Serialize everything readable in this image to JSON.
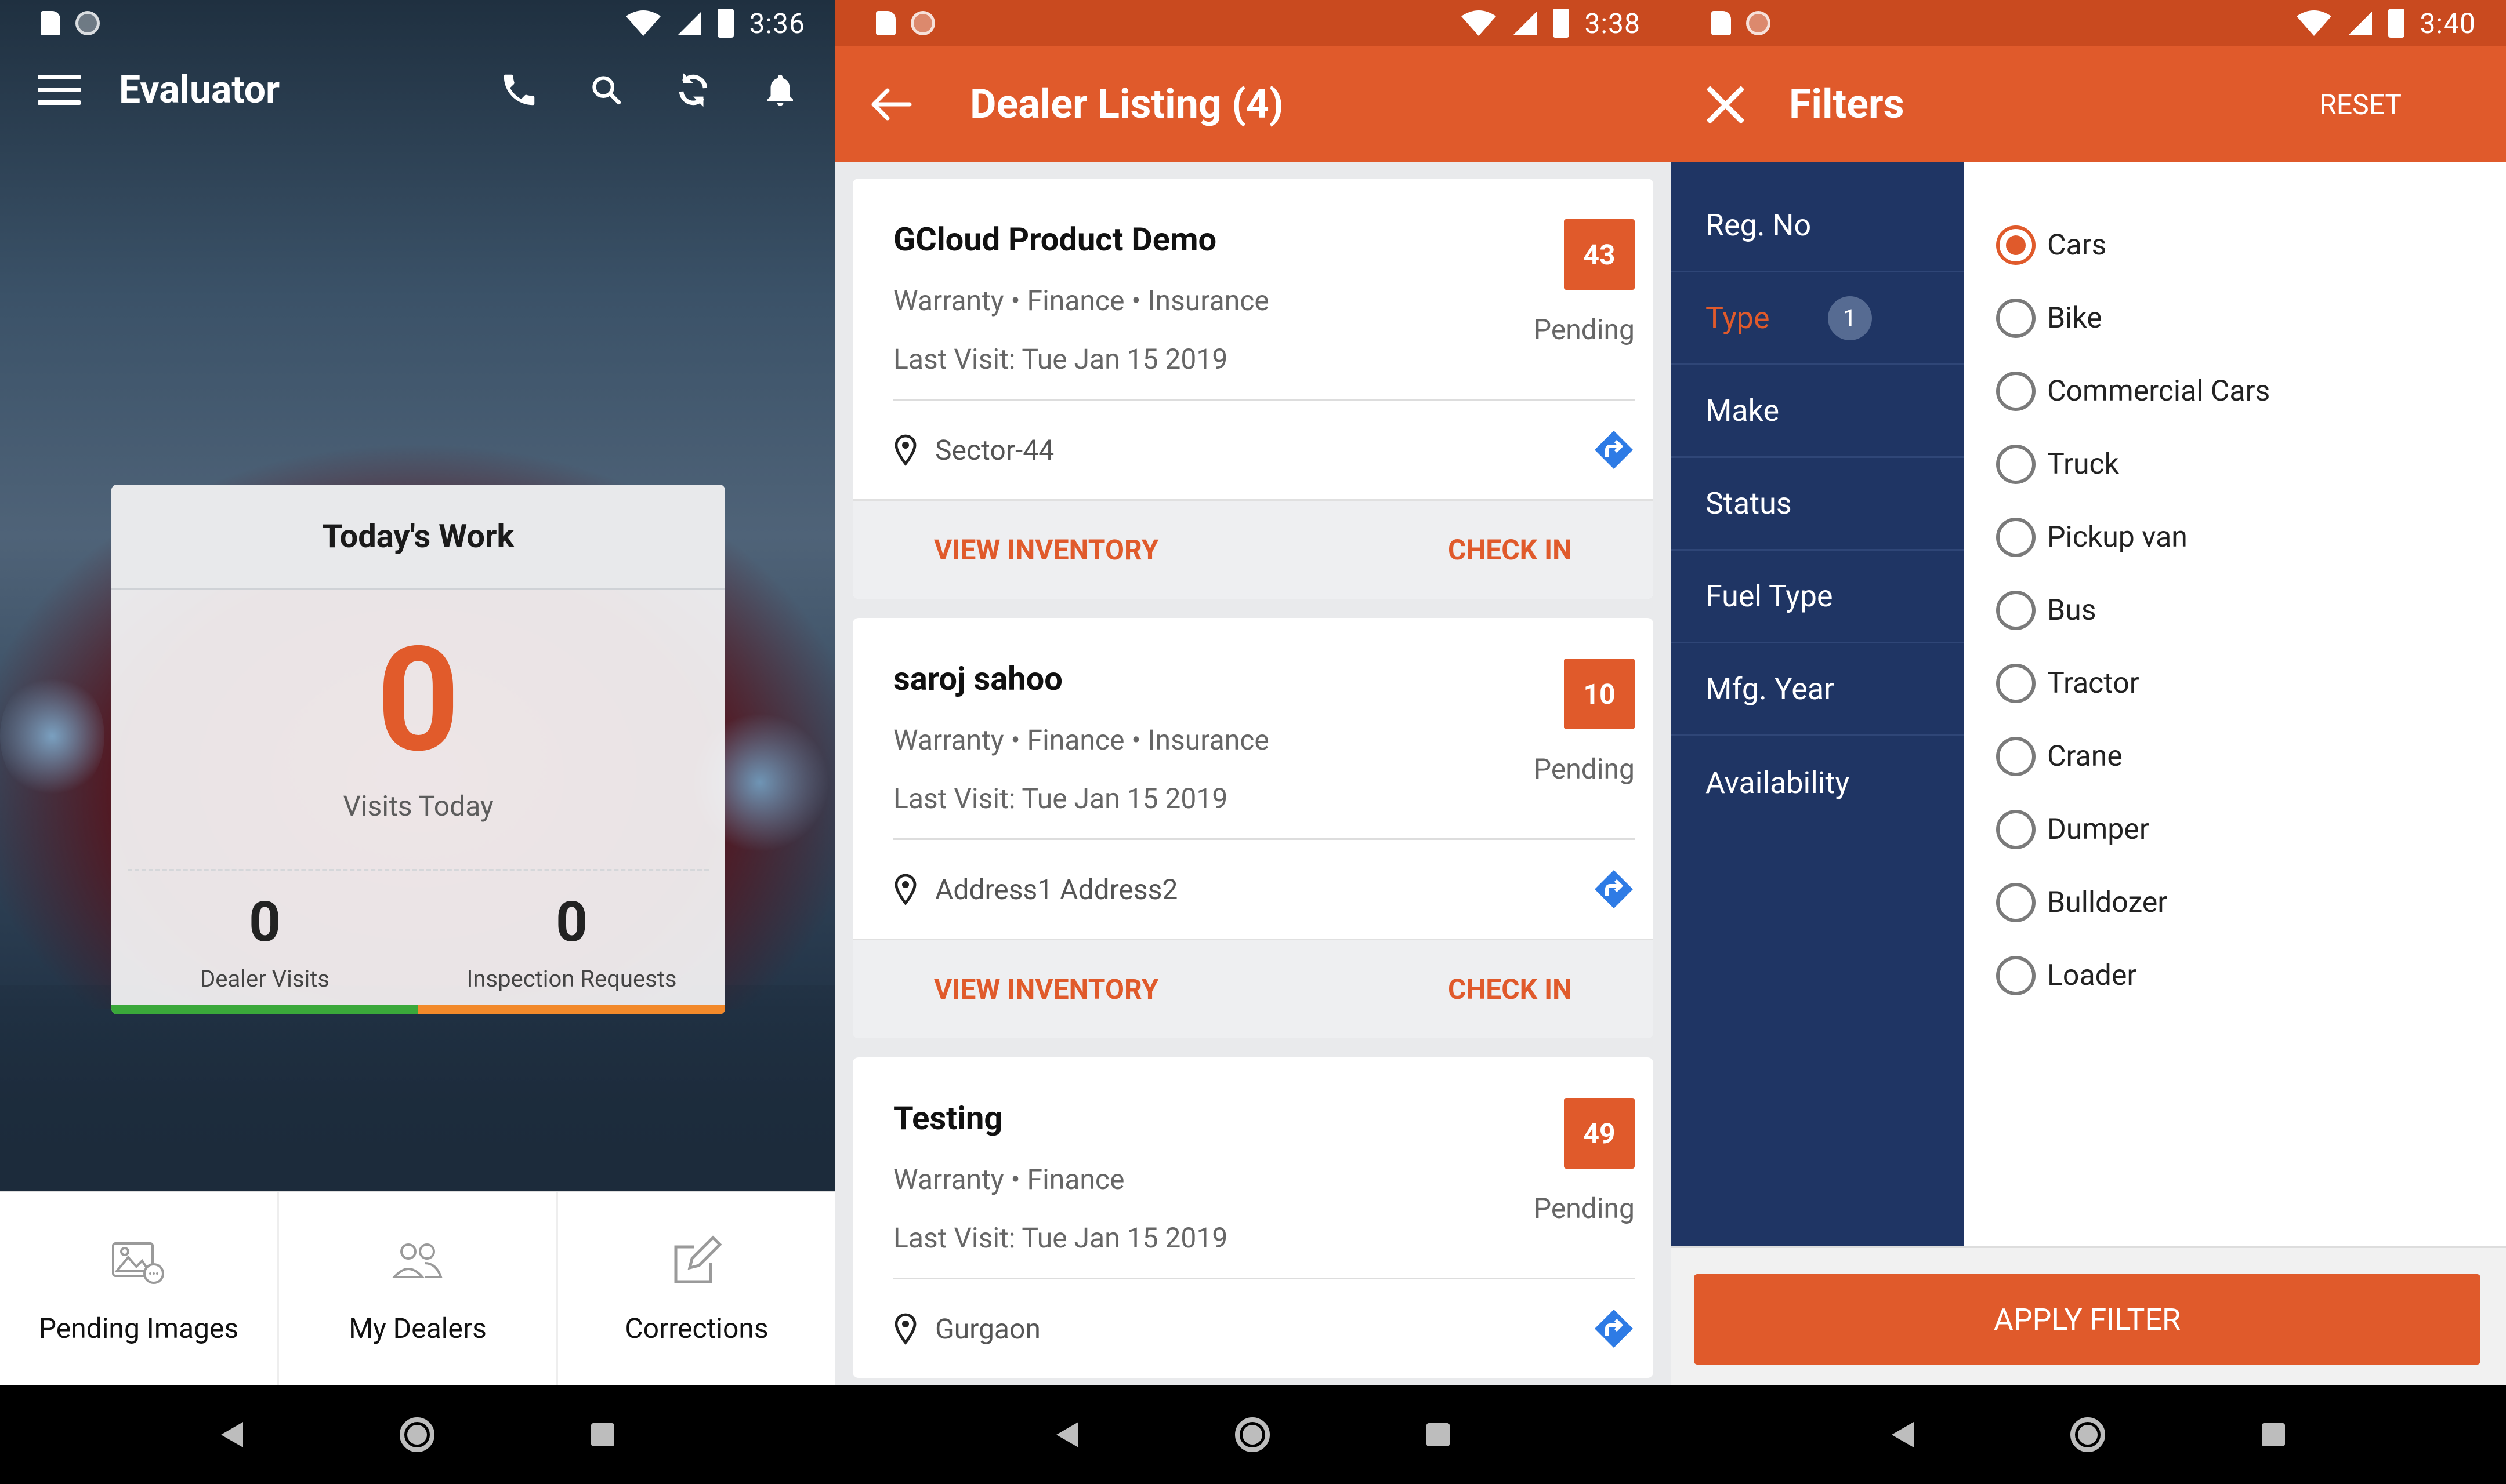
{
  "screens": {
    "home": {
      "status_time": "3:36",
      "title": "Evaluator",
      "card": {
        "title": "Today's Work",
        "visits_today": "0",
        "visits_label": "Visits Today",
        "dealer_visits": "0",
        "dealer_visits_label": "Dealer Visits",
        "inspection_requests": "0",
        "inspection_requests_label": "Inspection Requests"
      },
      "tabs": [
        {
          "label": "Pending Images",
          "icon": "image-icon"
        },
        {
          "label": "My Dealers",
          "icon": "people-icon"
        },
        {
          "label": "Corrections",
          "icon": "edit-icon"
        }
      ]
    },
    "dealers": {
      "status_time": "3:38",
      "title": "Dealer Listing (4)",
      "dealers": [
        {
          "name": "GCloud Product Demo",
          "tags": "Warranty • Finance • Insurance",
          "last_visit": "Last Visit: Tue Jan 15 2019",
          "count": "43",
          "status": "Pending",
          "address": "Sector-44",
          "view_inventory": "VIEW INVENTORY",
          "check_in": "CHECK IN"
        },
        {
          "name": "saroj sahoo",
          "tags": "Warranty • Finance • Insurance",
          "last_visit": "Last Visit: Tue Jan 15 2019",
          "count": "10",
          "status": "Pending",
          "address": "Address1 Address2",
          "view_inventory": "VIEW INVENTORY",
          "check_in": "CHECK IN"
        },
        {
          "name": "Testing",
          "tags": "Warranty • Finance",
          "last_visit": "Last Visit: Tue Jan 15 2019",
          "count": "49",
          "status": "Pending",
          "address": "Gurgaon"
        }
      ]
    },
    "filters": {
      "status_time": "3:40",
      "title": "Filters",
      "reset": "RESET",
      "categories": [
        {
          "label": "Reg. No"
        },
        {
          "label": "Type",
          "count": "1"
        },
        {
          "label": "Make"
        },
        {
          "label": "Status"
        },
        {
          "label": "Fuel Type"
        },
        {
          "label": "Mfg. Year"
        },
        {
          "label": "Availability"
        }
      ],
      "active_category": "Type",
      "options": [
        "Cars",
        "Bike",
        "Commercial Cars",
        "Truck",
        "Pickup van",
        "Bus",
        "Tractor",
        "Crane",
        "Dumper",
        "Bulldozer",
        "Loader"
      ],
      "selected_option": "Cars",
      "apply": "APPLY FILTER"
    }
  },
  "colors": {
    "accent": "#e05a2b",
    "status_orange": "#c94a1f",
    "sidebar_navy": "#1f3564",
    "green_bar": "#3aa83a",
    "orange_bar": "#f2892a"
  }
}
